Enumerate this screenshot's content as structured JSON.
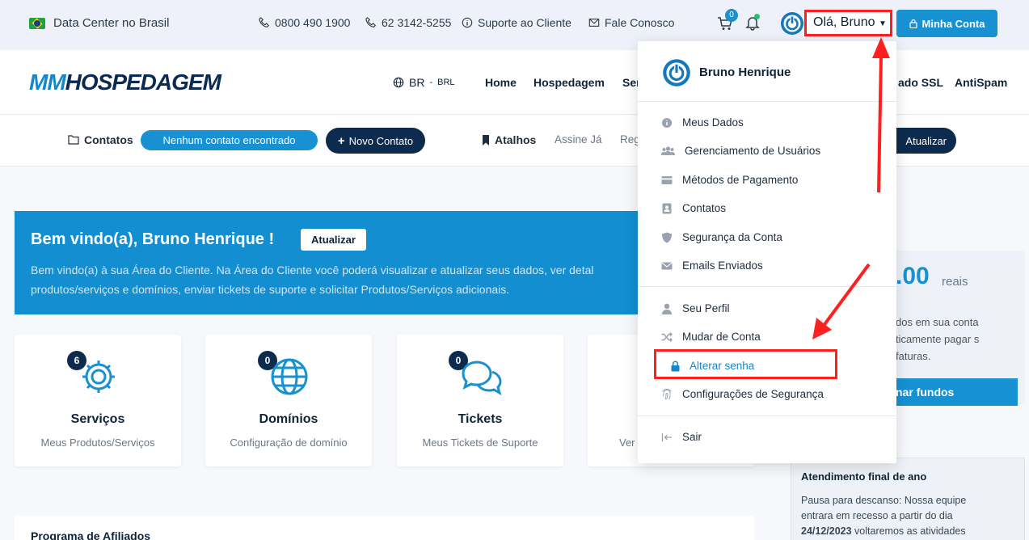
{
  "topbar": {
    "datacenter": "Data Center no Brasil",
    "phone1": "0800 490 1900",
    "phone2": "62 3142-5255",
    "support": "Suporte ao Cliente",
    "contact": "Fale Conosco",
    "cart_count": "0",
    "greeting": "Olá, Bruno",
    "account_button": "Minha Conta"
  },
  "header": {
    "logo_part1": "MM",
    "logo_part2": "HOSPEDAGEM",
    "locale": "BR",
    "currency": "BRL",
    "nav": [
      "Home",
      "Hospedagem",
      "Ser",
      "ado SSL",
      "AntiSpam"
    ]
  },
  "subbar": {
    "contacts_label": "Contatos",
    "no_contacts": "Nenhum contato encontrado",
    "new_contact": "Novo Contato",
    "shortcuts": "Atalhos",
    "shortcut1": "Assine Já",
    "shortcut2": "Reg",
    "refresh": "Atualizar"
  },
  "welcome": {
    "title": "Bem vindo(a), Bruno Henrique !",
    "update_button": "Atualizar",
    "text": "Bem vindo(a) à sua Área do Cliente. Na Área do Cliente você poderá visualizar e atualizar seus dados, ver detal produtos/serviços e domínios, enviar tickets de suporte e solicitar Produtos/Serviços adicionais."
  },
  "cards": [
    {
      "count": "6",
      "title": "Serviços",
      "subtitle": "Meus Produtos/Serviços",
      "icon": "gear-icon"
    },
    {
      "count": "0",
      "title": "Domínios",
      "subtitle": "Configuração de domínio",
      "icon": "globe-icon"
    },
    {
      "count": "0",
      "title": "Tickets",
      "subtitle": "Meus Tickets de Suporte",
      "icon": "chat-icon"
    },
    {
      "count": "",
      "title": "",
      "subtitle": "Ver",
      "icon": ""
    }
  ],
  "credit": {
    "amount": ".00",
    "unit": "reais",
    "text": "dos em sua conta ticamente pagar s faturas.",
    "add_button": "nar fundos"
  },
  "notice": {
    "title": "Atendimento final de ano",
    "body_pre": "Pausa para descanso: Nossa equipe entrara em recesso a partir do dia ",
    "body_date": "24/12/2023",
    "body_post": " voltaremos as atividades"
  },
  "affiliates": {
    "title": "Programa de Afiliados"
  },
  "dropdown": {
    "user_name": "Bruno Henrique",
    "items": [
      {
        "label": "Meus Dados",
        "icon": "info-icon"
      },
      {
        "label": "Gerenciamento de Usuários",
        "icon": "users-icon"
      },
      {
        "label": "Métodos de Pagamento",
        "icon": "card-icon"
      },
      {
        "label": "Contatos",
        "icon": "contact-icon"
      },
      {
        "label": "Segurança da Conta",
        "icon": "shield-icon"
      },
      {
        "label": "Emails Enviados",
        "icon": "envelope-icon"
      }
    ],
    "items2": [
      {
        "label": "Seu Perfil",
        "icon": "user-icon"
      },
      {
        "label": "Mudar de Conta",
        "icon": "shuffle-icon"
      },
      {
        "label": "Alterar senha",
        "icon": "lock-icon"
      },
      {
        "label": "Configurações de Segurança",
        "icon": "fingerprint-icon"
      }
    ],
    "logout": "Sair"
  },
  "colors": {
    "accent": "#1791d2",
    "dark": "#0d2b4e",
    "highlight": "#ff1f1f"
  }
}
